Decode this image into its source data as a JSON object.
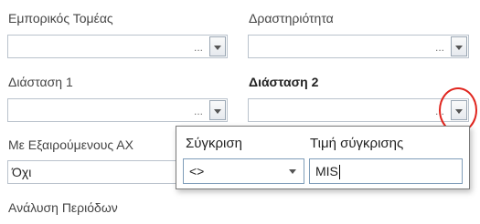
{
  "fields": {
    "business_sector": {
      "label": "Εμπορικός Τομέας",
      "ellipsis": "..."
    },
    "activity": {
      "label": "Δραστηριότητα",
      "ellipsis": "..."
    },
    "dimension1": {
      "label": "Διάσταση 1",
      "ellipsis": "..."
    },
    "dimension2": {
      "label": "Διάσταση 2",
      "ellipsis": "..."
    },
    "excluded": {
      "label": "Με Εξαιρούμενους ΑΧ",
      "value": "Όχι"
    },
    "period_analysis": {
      "label": "Ανάλυση Περιόδων"
    }
  },
  "popup": {
    "comparison_header": "Σύγκριση",
    "value_header": "Τιμή σύγκρισης",
    "comparison_value": "<>",
    "comparison_value_text": "MIS"
  },
  "colors": {
    "highlight": "#e0261f",
    "border": "#b9c2cc"
  }
}
